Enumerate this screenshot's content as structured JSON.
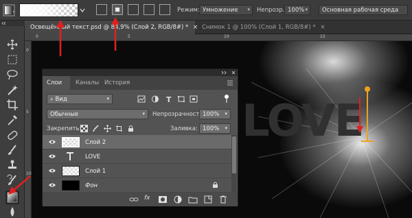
{
  "options_bar": {
    "mode_label": "Режим:",
    "mode_value": "Умножение",
    "opacity_label": "Непрозр.:",
    "opacity_value": "100%",
    "workspace_value": "Основная рабочая среда"
  },
  "document_tabs": [
    {
      "label": "Освещённый текст.psd @ 84,9% (Слой 2, RGB/8#) *",
      "close": "×"
    },
    {
      "label": "Снимок 1 @ 100% (Слой 1, RGB/8#) *",
      "close": "×"
    }
  ],
  "ruler": {
    "top_ticks": [
      "0",
      "5",
      "10",
      "15"
    ],
    "left_ticks": [
      "0",
      "5",
      "10"
    ]
  },
  "canvas": {
    "text": "LOVE",
    "colors": {
      "background": "#0a0a0a",
      "text": "#303030",
      "glow": "#ffffff",
      "marker": "#f0a020",
      "arrow": "#e02020"
    }
  },
  "layers_panel": {
    "tabs": [
      "Слои",
      "Каналы",
      "История"
    ],
    "filter_kind": "Вид",
    "blend_mode": "Обычные",
    "opacity_label": "Непрозрачность:",
    "opacity_value": "100%",
    "lock_label": "Закрепить:",
    "fill_label": "Заливка:",
    "fill_value": "100%",
    "layers": [
      {
        "name": "Слой 2",
        "thumb": "checker",
        "active": true
      },
      {
        "name": "LOVE",
        "thumb": "text-icon",
        "active": false
      },
      {
        "name": "Слой 1",
        "thumb": "checker",
        "active": false
      },
      {
        "name": "Фон",
        "thumb": "black",
        "active": false,
        "locked": true
      }
    ],
    "footer_fx": "fx"
  }
}
